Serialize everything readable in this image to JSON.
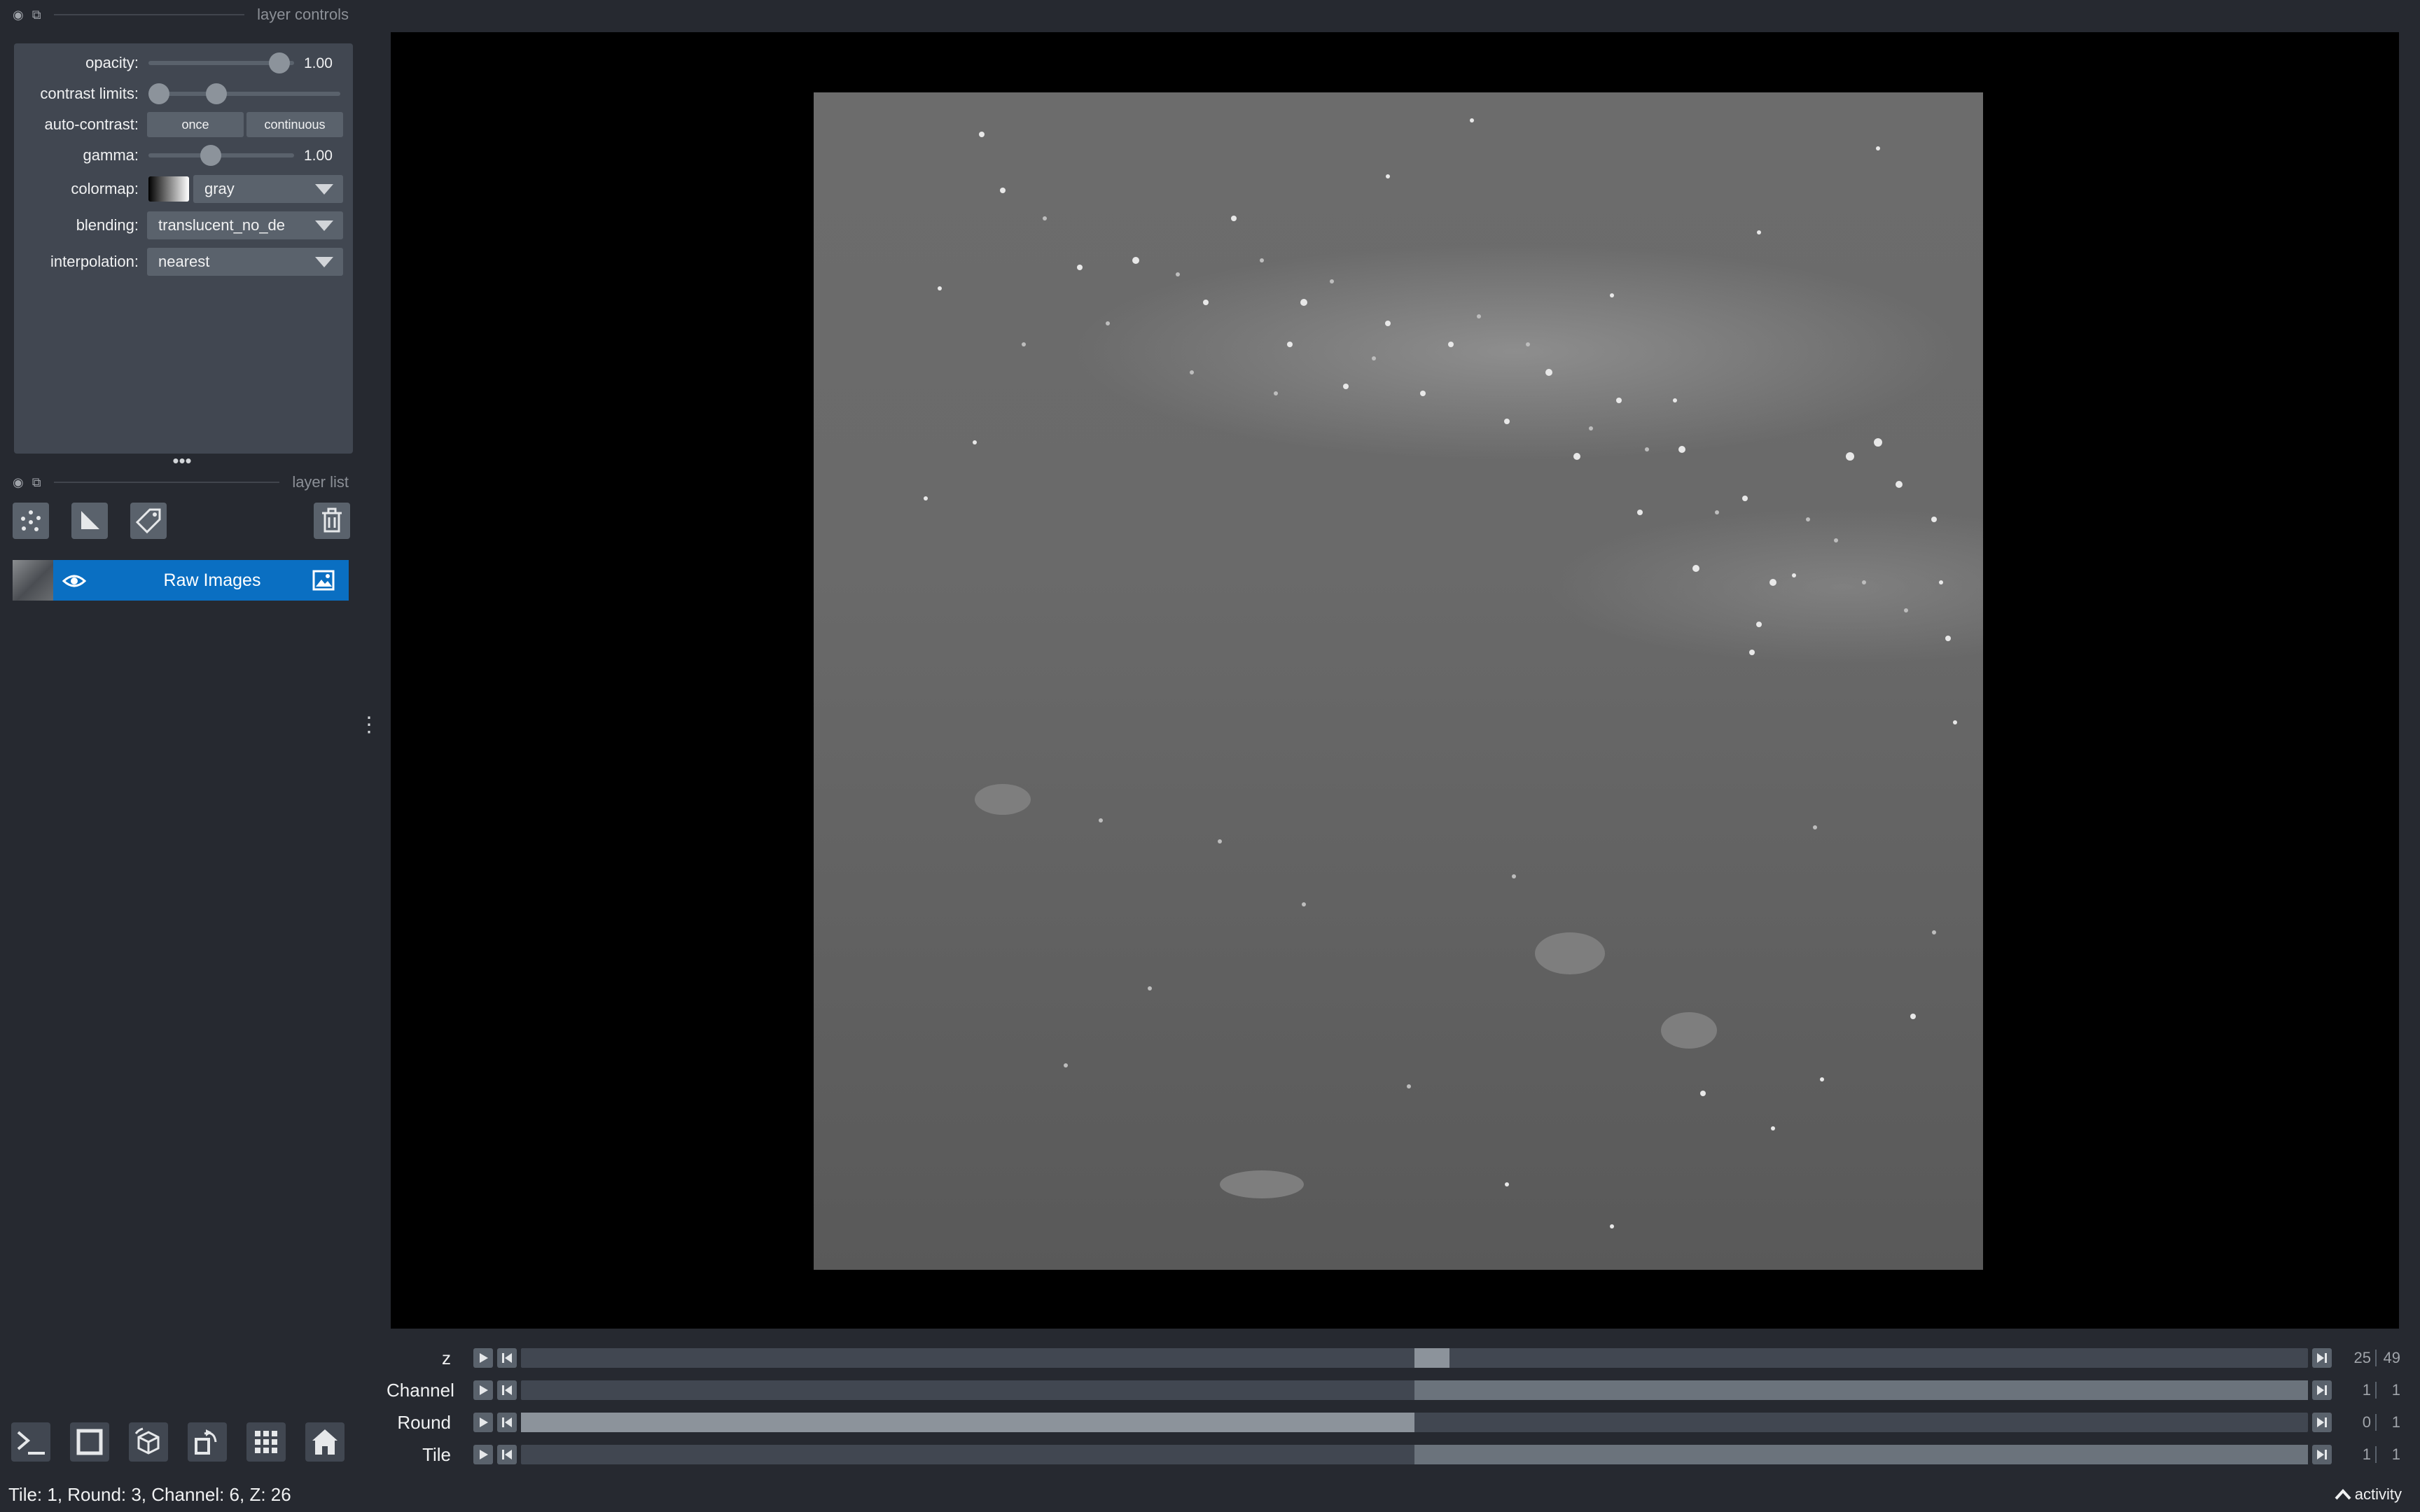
{
  "layer_controls": {
    "title": "layer controls",
    "opacity": {
      "label": "opacity:",
      "value": "1.00",
      "level": 1.0
    },
    "contrast_limits": {
      "label": "contrast limits:",
      "low": 0.0,
      "high": 0.3
    },
    "auto_contrast": {
      "label": "auto-contrast:",
      "once": "once",
      "continuous": "continuous"
    },
    "gamma": {
      "label": "gamma:",
      "value": "1.00",
      "level": 0.45
    },
    "colormap": {
      "label": "colormap:",
      "value": "gray"
    },
    "blending": {
      "label": "blending:",
      "value": "translucent_no_de"
    },
    "interpolation": {
      "label": "interpolation:",
      "value": "nearest"
    }
  },
  "layer_list": {
    "title": "layer list",
    "tool_icons": [
      "points-icon",
      "shapes-icon",
      "labels-icon",
      "delete-icon"
    ],
    "layers": [
      {
        "name": "Raw Images",
        "visible": true,
        "type_icon": "image-icon"
      }
    ]
  },
  "dims": [
    {
      "label": "z",
      "current": "25",
      "max": "49",
      "position": 0.5
    },
    {
      "label": "Channel",
      "current": "1",
      "max": "1",
      "position": 1.0
    },
    {
      "label": "Round",
      "current": "0",
      "max": "1",
      "position": 0.0
    },
    {
      "label": "Tile",
      "current": "1",
      "max": "1",
      "position": 1.0
    }
  ],
  "bottom_buttons": [
    "console-icon",
    "ndisplay-icon",
    "roll-dims-icon",
    "transpose-icon",
    "grid-icon",
    "home-icon"
  ],
  "status": {
    "text": "Tile: 1, Round: 3, Channel: 6, Z: 26",
    "activity": "activity"
  },
  "colors": {
    "accent": "#0a6fc2",
    "panel_bg": "#414751",
    "app_bg": "#262930"
  }
}
